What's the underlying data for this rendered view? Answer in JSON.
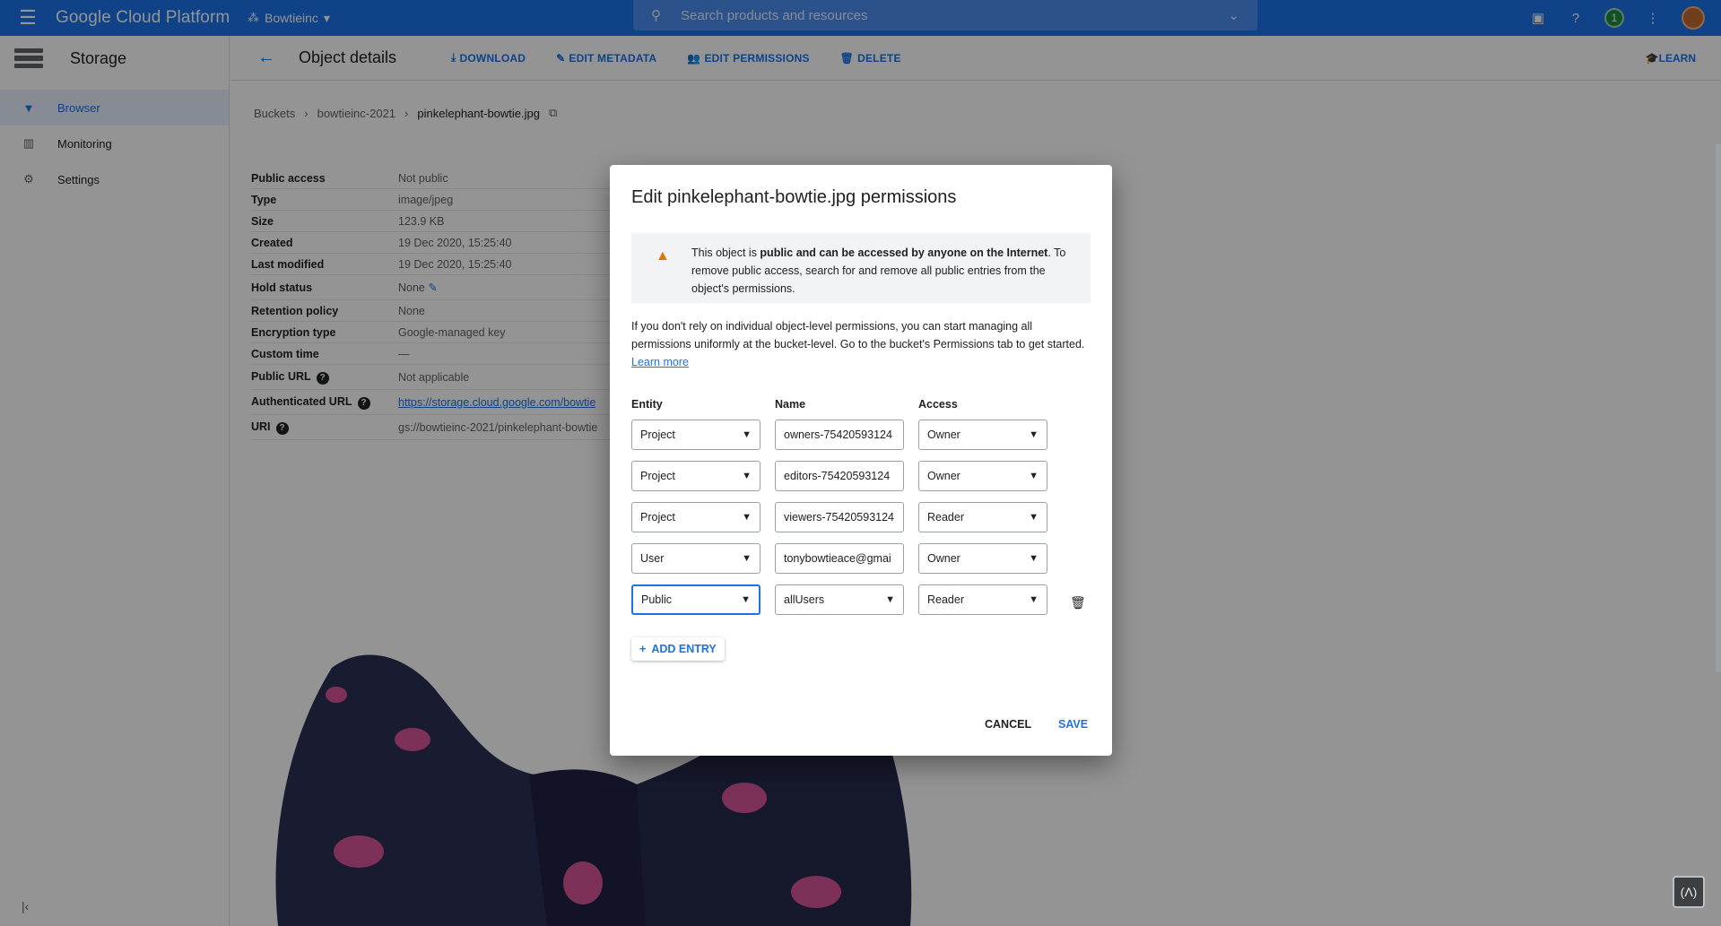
{
  "topbar": {
    "brand": "Google Cloud Platform",
    "project": "Bowtieinc",
    "search_placeholder": "Search products and resources",
    "notification_count": "1"
  },
  "sidebar": {
    "title": "Storage",
    "items": [
      {
        "label": "Browser",
        "icon": "bucket-icon",
        "active": true
      },
      {
        "label": "Monitoring",
        "icon": "chart-icon",
        "active": false
      },
      {
        "label": "Settings",
        "icon": "gear-icon",
        "active": false
      }
    ]
  },
  "actionbar": {
    "title": "Object details",
    "download": "DOWNLOAD",
    "edit_metadata": "EDIT METADATA",
    "edit_permissions": "EDIT PERMISSIONS",
    "delete": "DELETE",
    "learn": "LEARN"
  },
  "breadcrumb": {
    "buckets": "Buckets",
    "bucket": "bowtieinc-2021",
    "object": "pinkelephant-bowtie.jpg"
  },
  "details": [
    {
      "key": "Public access",
      "value": "Not public"
    },
    {
      "key": "Type",
      "value": "image/jpeg"
    },
    {
      "key": "Size",
      "value": "123.9 KB"
    },
    {
      "key": "Created",
      "value": "19 Dec 2020, 15:25:40"
    },
    {
      "key": "Last modified",
      "value": "19 Dec 2020, 15:25:40"
    },
    {
      "key": "Hold status",
      "value": "None"
    },
    {
      "key": "Retention policy",
      "value": "None"
    },
    {
      "key": "Encryption type",
      "value": "Google-managed key"
    },
    {
      "key": "Custom time",
      "value": "—"
    },
    {
      "key": "Public URL",
      "value": "Not applicable"
    },
    {
      "key": "Authenticated URL",
      "value": "https://storage.cloud.google.com/bowtie"
    },
    {
      "key": "URI",
      "value": "gs://bowtieinc-2021/pinkelephant-bowtie"
    }
  ],
  "dialog": {
    "title": "Edit pinkelephant-bowtie.jpg permissions",
    "warning_pre": "This object is ",
    "warning_bold": "public and can be accessed by anyone on the Internet",
    "warning_post": ". To remove public access, search for and remove all public entries from the object's permissions.",
    "info": "If you don't rely on individual object-level permissions, you can start managing all permissions uniformly at the bucket-level. Go to the bucket's Permissions tab to get started.",
    "learn_more": "Learn more",
    "col_entity": "Entity",
    "col_name": "Name",
    "col_access": "Access",
    "entries": [
      {
        "entity": "Project",
        "name": "owners-75420593124",
        "access": "Owner"
      },
      {
        "entity": "Project",
        "name": "editors-75420593124",
        "access": "Owner"
      },
      {
        "entity": "Project",
        "name": "viewers-75420593124",
        "access": "Reader"
      },
      {
        "entity": "User",
        "name": "tonybowtieace@gmai",
        "access": "Owner"
      },
      {
        "entity": "Public",
        "name": "allUsers",
        "access": "Reader"
      }
    ],
    "add_entry": "ADD ENTRY",
    "cancel": "CANCEL",
    "save": "SAVE"
  }
}
